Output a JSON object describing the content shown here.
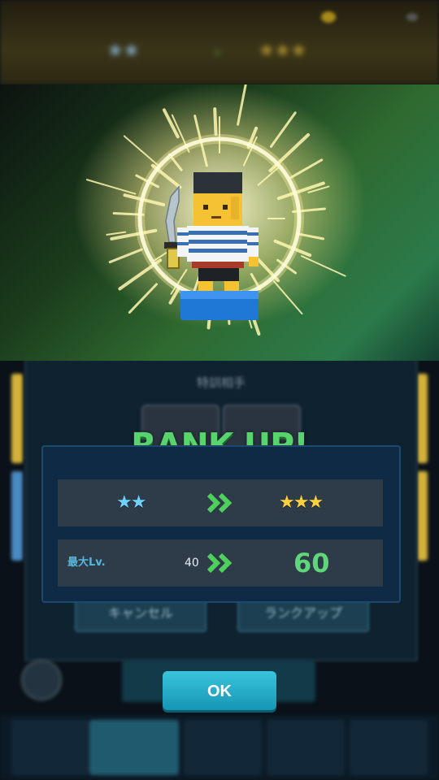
{
  "background": {
    "training_panel_title": "特訓相手",
    "cancel_label": "キャンセル",
    "rankup_label": "ランクアップ"
  },
  "modal": {
    "banner": "RANK UP!",
    "rank_row": {
      "from_stars": 2,
      "to_stars": 3,
      "from_star_color": "#6fd3ff",
      "to_star_color": "#ffd23a"
    },
    "level_row": {
      "label": "最大Lv.",
      "from_value": "40",
      "to_value": "60"
    }
  },
  "ok_button": {
    "label": "OK"
  },
  "colors": {
    "accent_green": "#58d36e",
    "button_cyan": "#1fb0cc",
    "modal_bg": "#0e2a44"
  },
  "icons": [
    "double-chevron-right-icon",
    "star-icon",
    "character-pirate-icon"
  ]
}
